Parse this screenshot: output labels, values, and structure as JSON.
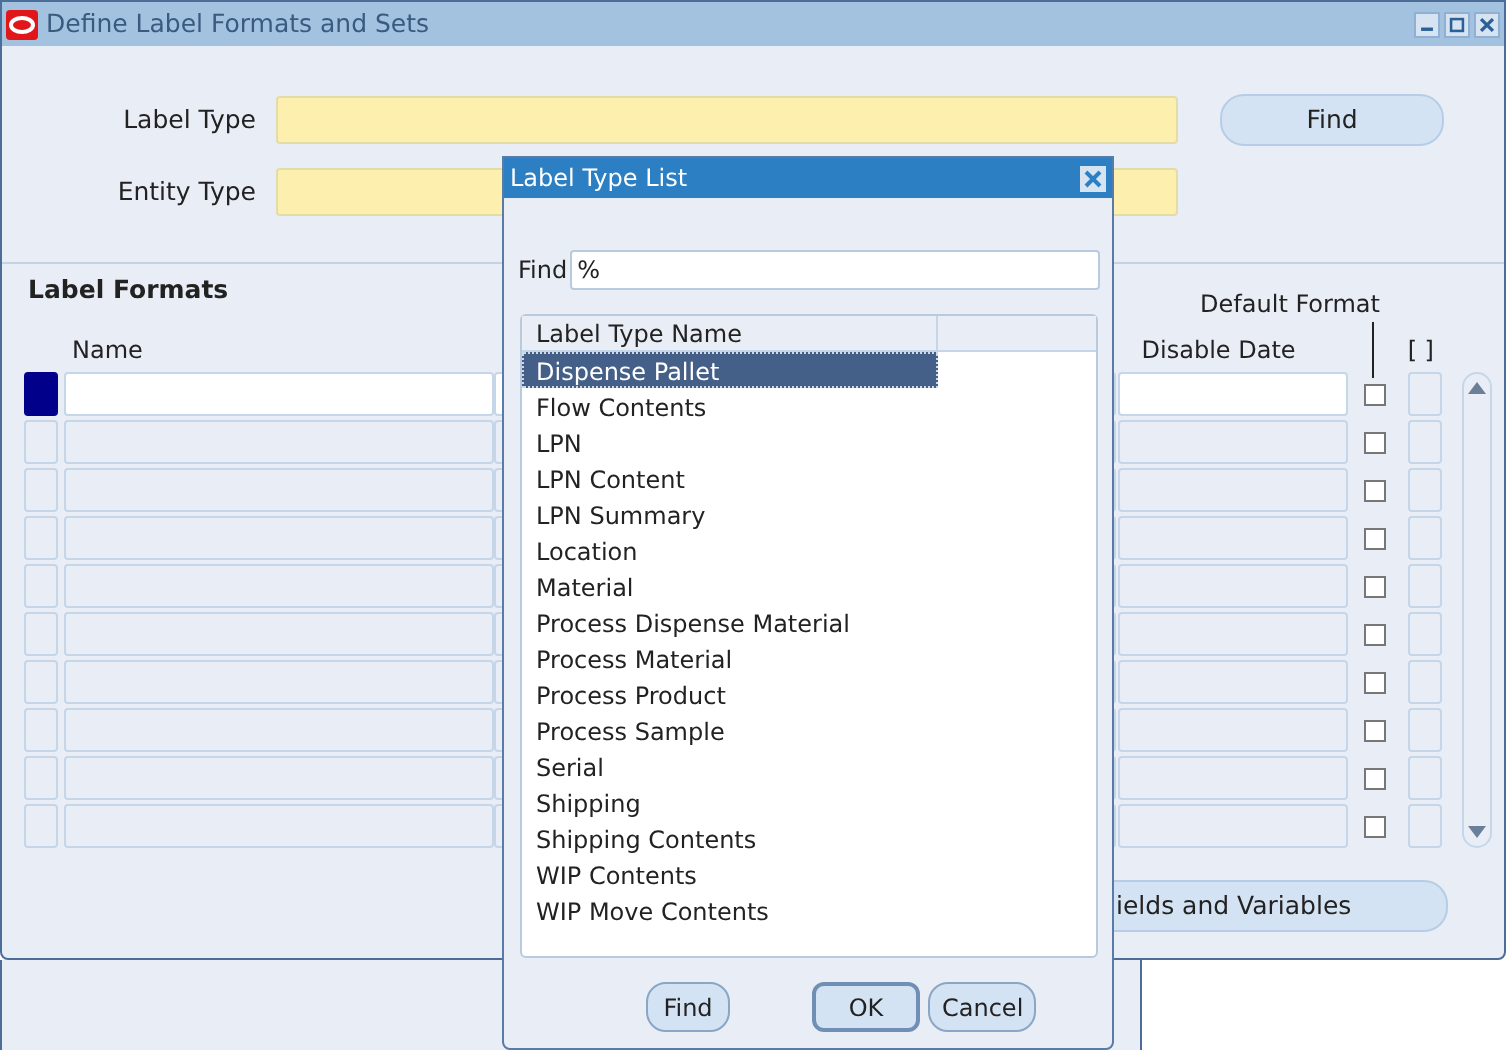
{
  "window": {
    "title": "Define Label Formats and Sets"
  },
  "header_fields": [
    {
      "label": "Label Type"
    },
    {
      "label": "Entity Type"
    }
  ],
  "find_button": "Find",
  "label_formats": {
    "title": "Label Formats",
    "default_format_heading": "Default Format",
    "columns": {
      "name": "Name",
      "disable_date": "Disable Date",
      "flex": "[ ]"
    },
    "rows": [
      {
        "selected": true,
        "default_format": false
      },
      {
        "selected": false,
        "default_format": false
      },
      {
        "selected": false,
        "default_format": false
      },
      {
        "selected": false,
        "default_format": false
      },
      {
        "selected": false,
        "default_format": false
      },
      {
        "selected": false,
        "default_format": false
      },
      {
        "selected": false,
        "default_format": false
      },
      {
        "selected": false,
        "default_format": false
      },
      {
        "selected": false,
        "default_format": false
      },
      {
        "selected": false,
        "default_format": false
      }
    ]
  },
  "fields_button": "ields and Variables",
  "dialog": {
    "title": "Label Type List",
    "find_label": "Find",
    "find_value": "%",
    "column": "Label Type Name",
    "items": [
      {
        "label": "Dispense Pallet",
        "selected": true
      },
      {
        "label": "Flow Contents",
        "selected": false
      },
      {
        "label": "LPN",
        "selected": false
      },
      {
        "label": "LPN Content",
        "selected": false
      },
      {
        "label": "LPN Summary",
        "selected": false
      },
      {
        "label": "Location",
        "selected": false
      },
      {
        "label": "Material",
        "selected": false
      },
      {
        "label": "Process Dispense Material",
        "selected": false
      },
      {
        "label": "Process Material",
        "selected": false
      },
      {
        "label": "Process Product",
        "selected": false
      },
      {
        "label": "Process Sample",
        "selected": false
      },
      {
        "label": "Serial",
        "selected": false
      },
      {
        "label": "Shipping",
        "selected": false
      },
      {
        "label": "Shipping Contents",
        "selected": false
      },
      {
        "label": "WIP Contents",
        "selected": false
      },
      {
        "label": "WIP Move Contents",
        "selected": false
      }
    ],
    "buttons": [
      {
        "label": "Find",
        "default": false
      },
      {
        "label": "OK",
        "default": true
      },
      {
        "label": "Cancel",
        "default": false
      }
    ]
  }
}
